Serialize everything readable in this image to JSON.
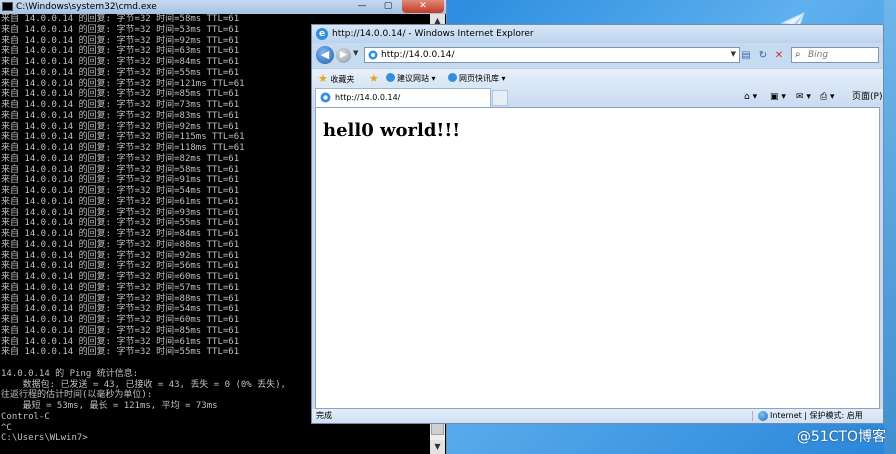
{
  "cmd": {
    "title": "C:\\Windows\\system32\\cmd.exe",
    "controls": {
      "minimize": "—",
      "maximize": "▢",
      "close": "✕"
    },
    "lines": [
      "来自 14.0.0.14 的回复: 字节=32 时间=58ms TTL=61",
      "来自 14.0.0.14 的回复: 字节=32 时间=53ms TTL=61",
      "来自 14.0.0.14 的回复: 字节=32 时间=92ms TTL=61",
      "来自 14.0.0.14 的回复: 字节=32 时间=63ms TTL=61",
      "来自 14.0.0.14 的回复: 字节=32 时间=84ms TTL=61",
      "来自 14.0.0.14 的回复: 字节=32 时间=55ms TTL=61",
      "来自 14.0.0.14 的回复: 字节=32 时间=121ms TTL=61",
      "来自 14.0.0.14 的回复: 字节=32 时间=85ms TTL=61",
      "来自 14.0.0.14 的回复: 字节=32 时间=73ms TTL=61",
      "来自 14.0.0.14 的回复: 字节=32 时间=83ms TTL=61",
      "来自 14.0.0.14 的回复: 字节=32 时间=92ms TTL=61",
      "来自 14.0.0.14 的回复: 字节=32 时间=115ms TTL=61",
      "来自 14.0.0.14 的回复: 字节=32 时间=118ms TTL=61",
      "来自 14.0.0.14 的回复: 字节=32 时间=82ms TTL=61",
      "来自 14.0.0.14 的回复: 字节=32 时间=58ms TTL=61",
      "来自 14.0.0.14 的回复: 字节=32 时间=91ms TTL=61",
      "来自 14.0.0.14 的回复: 字节=32 时间=54ms TTL=61",
      "来自 14.0.0.14 的回复: 字节=32 时间=61ms TTL=61",
      "来自 14.0.0.14 的回复: 字节=32 时间=93ms TTL=61",
      "来自 14.0.0.14 的回复: 字节=32 时间=55ms TTL=61",
      "来自 14.0.0.14 的回复: 字节=32 时间=84ms TTL=61",
      "来自 14.0.0.14 的回复: 字节=32 时间=88ms TTL=61",
      "来自 14.0.0.14 的回复: 字节=32 时间=92ms TTL=61",
      "来自 14.0.0.14 的回复: 字节=32 时间=56ms TTL=61",
      "来自 14.0.0.14 的回复: 字节=32 时间=60ms TTL=61",
      "来自 14.0.0.14 的回复: 字节=32 时间=57ms TTL=61",
      "来自 14.0.0.14 的回复: 字节=32 时间=88ms TTL=61",
      "来自 14.0.0.14 的回复: 字节=32 时间=54ms TTL=61",
      "来自 14.0.0.14 的回复: 字节=32 时间=60ms TTL=61",
      "来自 14.0.0.14 的回复: 字节=32 时间=85ms TTL=61",
      "来自 14.0.0.14 的回复: 字节=32 时间=61ms TTL=61",
      "来自 14.0.0.14 的回复: 字节=32 时间=55ms TTL=61",
      "",
      "14.0.0.14 的 Ping 统计信息:",
      "    数据包: 已发送 = 43, 已接收 = 43, 丢失 = 0 (0% 丢失),",
      "往返行程的估计时间(以毫秒为单位):",
      "    最短 = 53ms, 最长 = 121ms, 平均 = 73ms",
      "Control-C",
      "^C",
      "C:\\Users\\WLwin7>"
    ],
    "scroll": {
      "up": "▲",
      "down": "▼"
    }
  },
  "ie": {
    "title": "http://14.0.0.14/ - Windows Internet Explorer",
    "app_icon": "e",
    "nav": {
      "back": "◀",
      "forward": "▶",
      "dropdown": "▼",
      "address": "http://14.0.0.14/",
      "compat": "▤",
      "refresh": "↻",
      "stop": "✕",
      "search_icon": "⌕",
      "search_placeholder": "Bing"
    },
    "favbar": {
      "star": "★",
      "favorites": "收藏夹",
      "add_star": "★",
      "suggested_sites": "建议网站 ▾",
      "web_slices": "网页快讯库 ▾"
    },
    "tab": {
      "label": "http://14.0.0.14/"
    },
    "commandbar": {
      "home": "⌂ ▾",
      "rss": "▣ ▾",
      "mail": "✉ ▾",
      "print": "⎙ ▾",
      "page": "页面(P) ▾"
    },
    "content": {
      "heading": "hell0 world!!!"
    },
    "status": {
      "text": "完成",
      "zone": "Internet | 保护模式: 启用"
    }
  },
  "desktop": {
    "watermark": "@51CTO博客"
  },
  "colors": {
    "console_bg": "#000000",
    "console_text": "#c0c0c0",
    "desktop_blue": "#2e8fe0",
    "ie_frame": "#c7dbf0"
  }
}
